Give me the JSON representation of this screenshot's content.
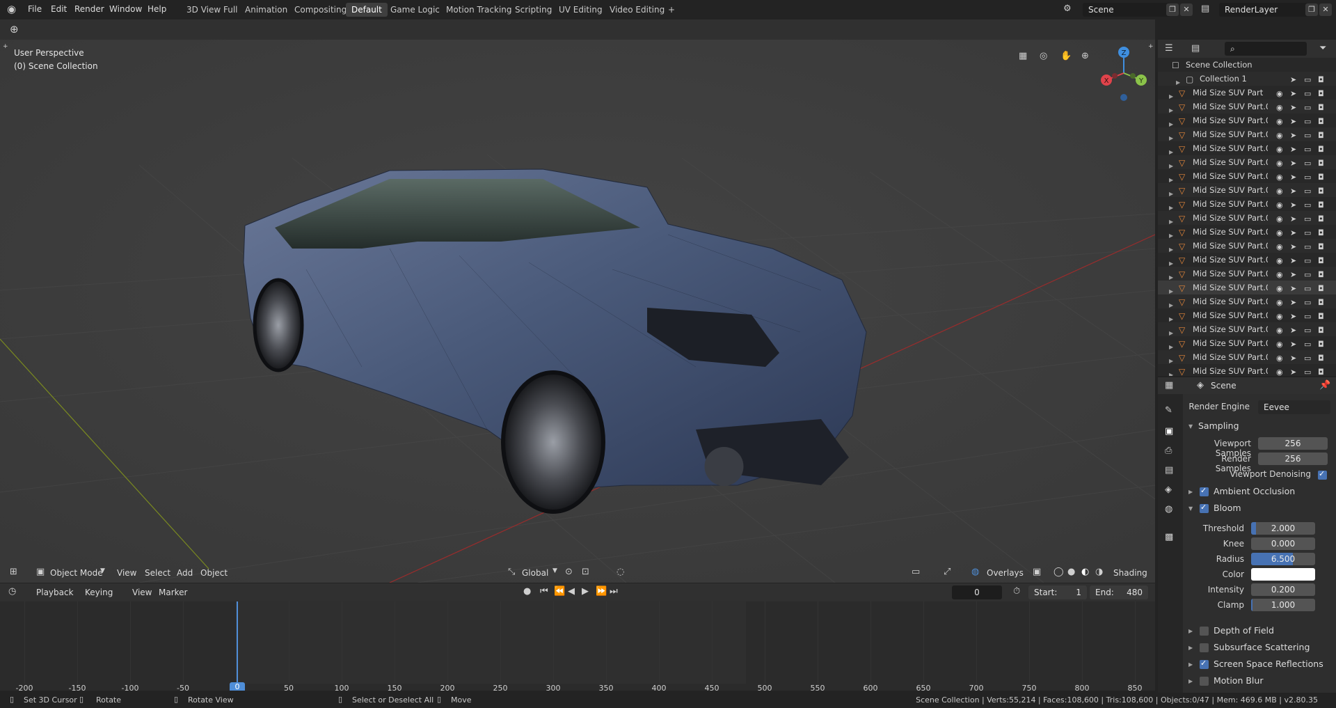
{
  "app": {
    "menu": [
      "File",
      "Edit",
      "Render",
      "Window",
      "Help"
    ],
    "workspaces": [
      "3D View Full",
      "Animation",
      "Compositing",
      "Default",
      "Game Logic",
      "Motion Tracking",
      "Scripting",
      "UV Editing",
      "Video Editing"
    ],
    "active_workspace": "Default",
    "add_tab": "+",
    "scene_name": "Scene",
    "view_layer": "RenderLayer"
  },
  "viewport": {
    "perspective_label": "User Perspective",
    "collection_label": "(0) Scene Collection",
    "mode": "Object Mode",
    "menus": [
      "View",
      "Select",
      "Add",
      "Object"
    ],
    "orientation": "Global",
    "overlays_label": "Overlays",
    "shading_label": "Shading",
    "gizmo": {
      "x": "X",
      "y": "Y",
      "z": "Z"
    },
    "colors": {
      "x_axis": "#e0434b",
      "y_axis": "#8bc34a",
      "z_axis": "#3f8fe0",
      "car_body": "#4a5a7a"
    }
  },
  "timeline": {
    "menus": [
      "Playback",
      "Keying",
      "View",
      "Marker"
    ],
    "current_frame": "0",
    "start_label": "Start:",
    "start": "1",
    "end_label": "End:",
    "end": "480",
    "ticks": [
      "-200",
      "-150",
      "-100",
      "-50",
      "0",
      "50",
      "100",
      "150",
      "200",
      "250",
      "300",
      "350",
      "400",
      "450",
      "500",
      "550",
      "600",
      "650",
      "700",
      "750",
      "800",
      "850"
    ],
    "playhead_label": "0"
  },
  "outliner": {
    "root": "Scene Collection",
    "collection": "Collection 1",
    "items": [
      "Mid Size SUV Part",
      "Mid Size SUV Part.0",
      "Mid Size SUV Part.0",
      "Mid Size SUV Part.0",
      "Mid Size SUV Part.0",
      "Mid Size SUV Part.0",
      "Mid Size SUV Part.0",
      "Mid Size SUV Part.0",
      "Mid Size SUV Part.0",
      "Mid Size SUV Part.0",
      "Mid Size SUV Part.0",
      "Mid Size SUV Part.0",
      "Mid Size SUV Part.0",
      "Mid Size SUV Part.0",
      "Mid Size SUV Part.0",
      "Mid Size SUV Part.0",
      "Mid Size SUV Part.0",
      "Mid Size SUV Part.0",
      "Mid Size SUV Part.0",
      "Mid Size SUV Part.0",
      "Mid Size SUV Part.0"
    ],
    "selected_index": 14
  },
  "properties": {
    "context": "Scene",
    "render_engine_label": "Render Engine",
    "render_engine": "Eevee",
    "sampling": {
      "title": "Sampling",
      "viewport_samples_label": "Viewport Samples",
      "viewport_samples": "256",
      "render_samples_label": "Render Samples",
      "render_samples": "256",
      "denoise_label": "Viewport Denoising"
    },
    "ambient_occlusion": "Ambient Occlusion",
    "bloom": {
      "title": "Bloom",
      "threshold_label": "Threshold",
      "threshold": "2.000",
      "threshold_fill": 0.08,
      "knee_label": "Knee",
      "knee": "0.000",
      "knee_fill": 0.0,
      "radius_label": "Radius",
      "radius": "6.500",
      "radius_fill": 0.65,
      "color_label": "Color",
      "color": "#ffffff",
      "intensity_label": "Intensity",
      "intensity": "0.200",
      "intensity_fill": 0.0,
      "clamp_label": "Clamp",
      "clamp": "1.000",
      "clamp_fill": 0.02
    },
    "sections_after": [
      {
        "label": "Depth of Field",
        "checked": false
      },
      {
        "label": "Subsurface Scattering",
        "checked": false
      },
      {
        "label": "Screen Space Reflections",
        "checked": true
      },
      {
        "label": "Motion Blur",
        "checked": false
      }
    ]
  },
  "status": {
    "hint1": "Set 3D Cursor",
    "hint2": "Rotate",
    "hint3": "Rotate View",
    "hint4": "Select or Deselect All",
    "hint5": "Move",
    "stats": "Scene Collection | Verts:55,214 | Faces:108,600 | Tris:108,600 | Objects:0/47 | Mem: 469.6 MB | v2.80.35"
  }
}
